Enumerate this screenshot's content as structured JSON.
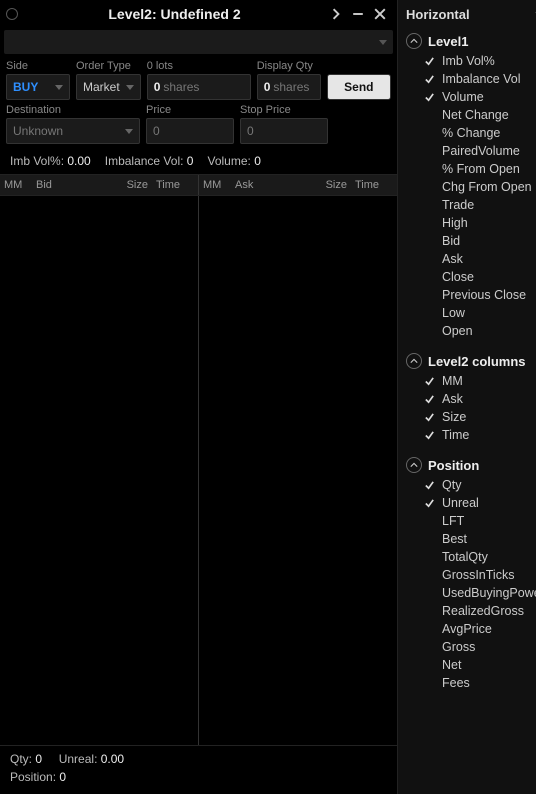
{
  "title": "Level2: Undefined 2",
  "side_title": "Horizontal",
  "form": {
    "side_label": "Side",
    "side_value": "BUY",
    "order_type_label": "Order Type",
    "order_type_value": "Market",
    "lots_label": "0 lots",
    "lots_value": "0",
    "lots_unit": "shares",
    "display_qty_label": "Display Qty",
    "display_qty_value": "0",
    "display_qty_unit": "shares",
    "send_label": "Send",
    "destination_label": "Destination",
    "destination_value": "Unknown",
    "price_label": "Price",
    "price_value": "0",
    "stop_price_label": "Stop Price",
    "stop_price_value": "0"
  },
  "stats": {
    "imb_vol_label": "Imb Vol%:",
    "imb_vol_value": "0.00",
    "imbalance_vol_label": "Imbalance Vol:",
    "imbalance_vol_value": "0",
    "volume_label": "Volume:",
    "volume_value": "0"
  },
  "cols": {
    "mm": "MM",
    "bid": "Bid",
    "ask": "Ask",
    "size": "Size",
    "time": "Time"
  },
  "footer": {
    "qty_label": "Qty:",
    "qty_value": "0",
    "unreal_label": "Unreal:",
    "unreal_value": "0.00",
    "position_label": "Position:",
    "position_value": "0"
  },
  "groups": [
    {
      "label": "Level1",
      "items": [
        {
          "label": "Imb Vol%",
          "checked": true
        },
        {
          "label": "Imbalance Vol",
          "checked": true
        },
        {
          "label": "Volume",
          "checked": true
        },
        {
          "label": "Net Change",
          "checked": false
        },
        {
          "label": "% Change",
          "checked": false
        },
        {
          "label": "PairedVolume",
          "checked": false
        },
        {
          "label": "% From Open",
          "checked": false
        },
        {
          "label": "Chg From Open",
          "checked": false
        },
        {
          "label": "Trade",
          "checked": false
        },
        {
          "label": "High",
          "checked": false
        },
        {
          "label": "Bid",
          "checked": false
        },
        {
          "label": "Ask",
          "checked": false
        },
        {
          "label": "Close",
          "checked": false
        },
        {
          "label": "Previous Close",
          "checked": false
        },
        {
          "label": "Low",
          "checked": false
        },
        {
          "label": "Open",
          "checked": false
        }
      ]
    },
    {
      "label": "Level2 columns",
      "items": [
        {
          "label": "MM",
          "checked": true
        },
        {
          "label": "Ask",
          "checked": true
        },
        {
          "label": "Size",
          "checked": true
        },
        {
          "label": "Time",
          "checked": true
        }
      ]
    },
    {
      "label": "Position",
      "items": [
        {
          "label": "Qty",
          "checked": true
        },
        {
          "label": "Unreal",
          "checked": true
        },
        {
          "label": "LFT",
          "checked": false
        },
        {
          "label": "Best",
          "checked": false
        },
        {
          "label": "TotalQty",
          "checked": false
        },
        {
          "label": "GrossInTicks",
          "checked": false
        },
        {
          "label": "UsedBuyingPower",
          "checked": false
        },
        {
          "label": "RealizedGross",
          "checked": false
        },
        {
          "label": "AvgPrice",
          "checked": false
        },
        {
          "label": "Gross",
          "checked": false
        },
        {
          "label": "Net",
          "checked": false
        },
        {
          "label": "Fees",
          "checked": false
        }
      ]
    }
  ]
}
